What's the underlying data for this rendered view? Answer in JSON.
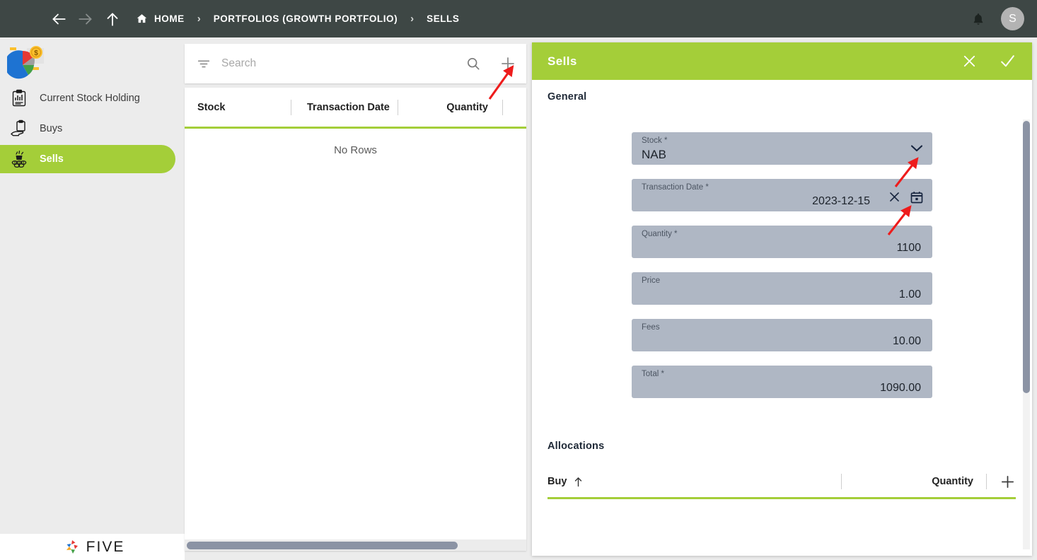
{
  "topbar": {
    "menu_icon": "hamburger-menu-icon",
    "back_icon": "arrow-back-icon",
    "forward_icon": "arrow-forward-icon",
    "up_icon": "arrow-up-icon",
    "breadcrumbs": [
      {
        "label": "HOME",
        "icon": "home-icon"
      },
      {
        "label": "PORTFOLIOS (GROWTH PORTFOLIO)",
        "icon": ""
      },
      {
        "label": "SELLS",
        "icon": ""
      }
    ],
    "separator": "›",
    "bell_icon": "notification-bell-icon",
    "avatar_initial": "S"
  },
  "sidebar": {
    "logo_icon": "pie-chart-money-logo",
    "items": [
      {
        "label": "Current Stock Holding",
        "icon": "clipboard-chart-icon",
        "active": false
      },
      {
        "label": "Buys",
        "icon": "hand-clipboard-icon",
        "active": false
      },
      {
        "label": "Sells",
        "icon": "money-stack-icon",
        "active": true
      }
    ],
    "brand_text": "FIVE",
    "brand_icon": "five-pinwheel-logo"
  },
  "list": {
    "search_placeholder": "Search",
    "search_value": "",
    "filter_icon": "filter-icon",
    "search_icon": "search-icon",
    "add_icon": "plus-icon",
    "columns": [
      "Stock",
      "Transaction Date",
      "Quantity"
    ],
    "empty_message": "No Rows"
  },
  "form": {
    "title": "Sells",
    "close_icon": "close-x-icon",
    "confirm_icon": "checkmark-icon",
    "general_section": "General",
    "fields": [
      {
        "label": "Stock *",
        "value": "NAB",
        "align": "left",
        "icons": [
          "chevron-down-icon"
        ]
      },
      {
        "label": "Transaction Date *",
        "value": "2023-12-15",
        "align": "right",
        "icons": [
          "clear-x-icon",
          "calendar-icon"
        ]
      },
      {
        "label": "Quantity *",
        "value": "1100",
        "align": "right",
        "icons": []
      },
      {
        "label": "Price",
        "value": "1.00",
        "align": "right",
        "icons": []
      },
      {
        "label": "Fees",
        "value": "10.00",
        "align": "right",
        "icons": []
      },
      {
        "label": "Total *",
        "value": "1090.00",
        "align": "right",
        "icons": []
      }
    ],
    "allocations_section": "Allocations",
    "allocations_columns": [
      "Buy",
      "Quantity"
    ],
    "allocations_sort_icon": "sort-ascending-arrow-icon",
    "allocations_add_icon": "plus-icon"
  },
  "colors": {
    "header_bg": "#3e4745",
    "accent_green": "#a4ce39",
    "field_bg": "#afb7c4",
    "page_bg": "#ececec",
    "annotation_red": "#ee1c1c",
    "scrollbar": "#8b93a4"
  }
}
